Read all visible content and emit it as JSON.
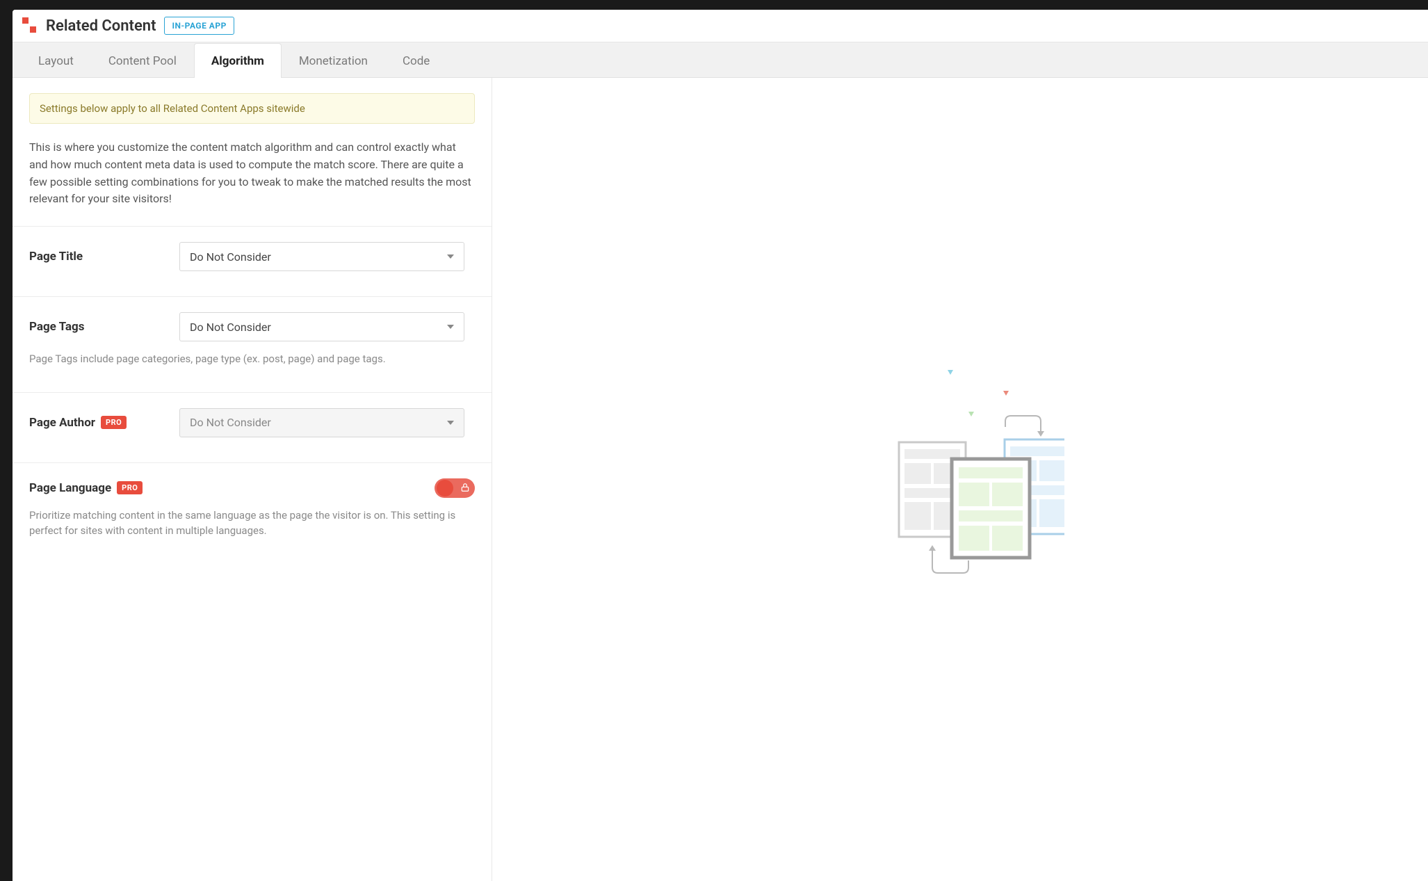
{
  "header": {
    "title": "Related Content",
    "badge": "IN-PAGE APP"
  },
  "tabs": [
    "Layout",
    "Content Pool",
    "Algorithm",
    "Monetization",
    "Code"
  ],
  "activeTabIndex": 2,
  "notice": "Settings below apply to all Related Content Apps sitewide",
  "intro": "This is where you customize the content match algorithm and can control exactly what and how much content meta data is used to compute the match score. There are quite a few possible setting combinations for you to tweak to make the matched results the most relevant for your site visitors!",
  "fields": {
    "pageTitle": {
      "label": "Page Title",
      "value": "Do Not Consider"
    },
    "pageTags": {
      "label": "Page Tags",
      "value": "Do Not Consider",
      "help": "Page Tags include page categories, page type (ex. post, page) and page tags."
    },
    "pageAuthor": {
      "label": "Page Author",
      "pro": "PRO",
      "value": "Do Not Consider"
    },
    "pageLanguage": {
      "label": "Page Language",
      "pro": "PRO",
      "help": "Prioritize matching content in the same language as the page the visitor is on. This setting is perfect for sites with content in multiple languages."
    }
  }
}
